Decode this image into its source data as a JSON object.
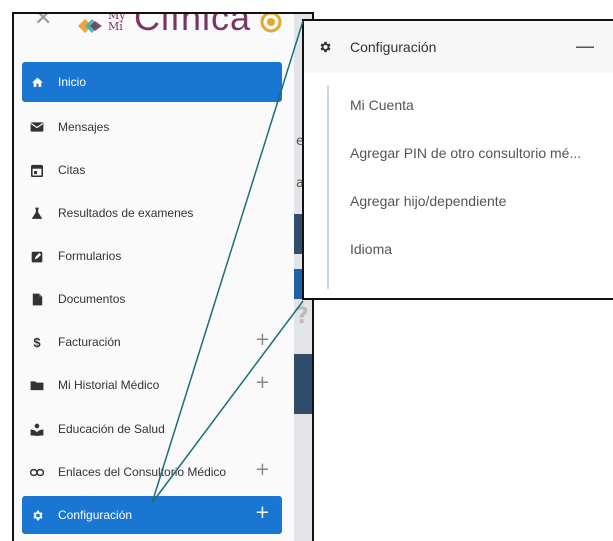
{
  "header": {
    "close_icon": "close-icon",
    "logo_small": "My\nMí",
    "logo_text": "Clínica"
  },
  "sidebar": {
    "items": [
      {
        "label": "Inicio",
        "icon": "home-icon",
        "active": true,
        "expandable": false
      },
      {
        "label": "Mensajes",
        "icon": "envelope-icon",
        "active": false,
        "expandable": false
      },
      {
        "label": "Citas",
        "icon": "calendar-icon",
        "active": false,
        "expandable": false
      },
      {
        "label": "Resultados de examenes",
        "icon": "flask-icon",
        "active": false,
        "expandable": false
      },
      {
        "label": "Formularios",
        "icon": "form-edit-icon",
        "active": false,
        "expandable": false
      },
      {
        "label": "Documentos",
        "icon": "document-icon",
        "active": false,
        "expandable": false
      },
      {
        "label": "Facturación",
        "icon": "dollar-icon",
        "active": false,
        "expandable": true
      },
      {
        "label": "Mi Historial Médico",
        "icon": "folder-icon",
        "active": false,
        "expandable": true
      },
      {
        "label": "Educación de Salud",
        "icon": "reader-icon",
        "active": false,
        "expandable": false
      },
      {
        "label": "Enlaces del Consultorio Médico",
        "icon": "link-icon",
        "active": false,
        "expandable": true
      },
      {
        "label": "Configuración",
        "icon": "gear-icon",
        "active": true,
        "expandable": true
      }
    ],
    "expand_symbol": "+"
  },
  "popup": {
    "title": "Configuración",
    "collapse_symbol": "—",
    "items": [
      "Mi Cuenta",
      "Agregar PIN de otro consultorio mé...",
      "Agregar hijo/dependiente",
      "Idioma"
    ]
  },
  "colors": {
    "accent": "#1976d2",
    "brand": "#7a3566",
    "callout_line": "#1b6f7a"
  }
}
